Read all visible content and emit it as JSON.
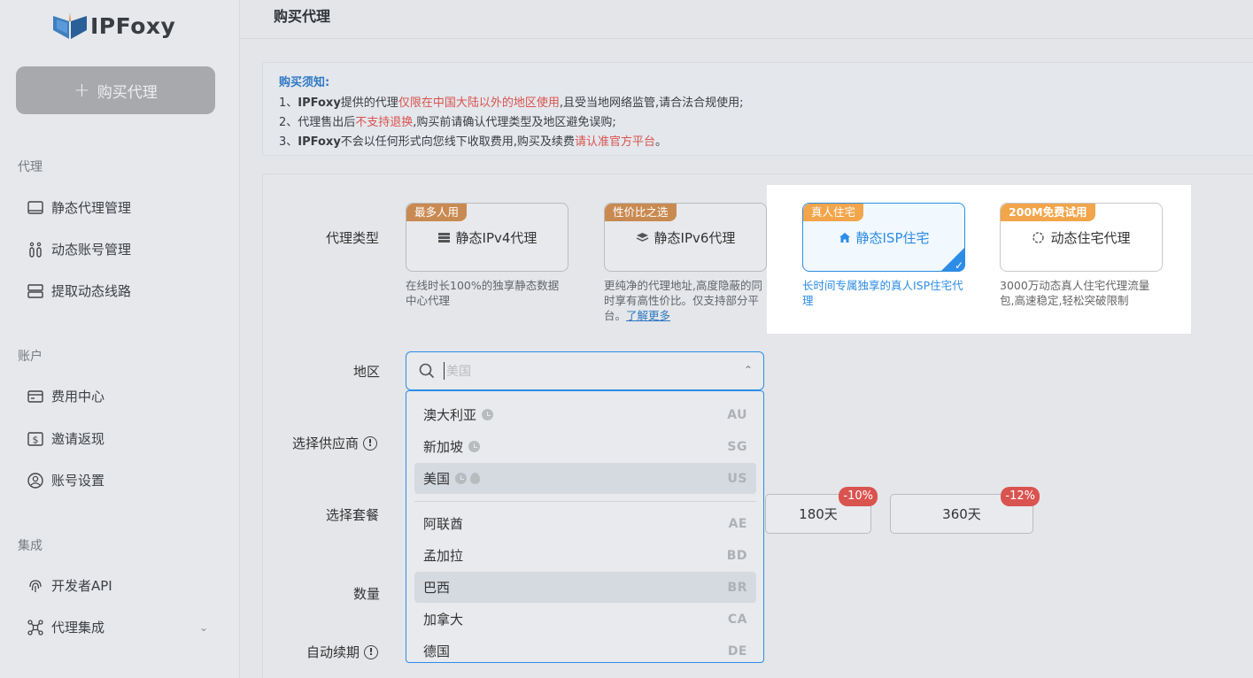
{
  "app": {
    "logo_text": "IPFoxy"
  },
  "sidebar": {
    "buy_button": "购买代理",
    "sections": {
      "proxy": "代理",
      "account": "账户",
      "integration": "集成"
    },
    "items": {
      "static_proxy": "静态代理管理",
      "dynamic_account": "动态账号管理",
      "extract_dynamic": "提取动态线路",
      "billing": "费用中心",
      "invite": "邀请返现",
      "account_settings": "账号设置",
      "developer_api": "开发者API",
      "proxy_integration": "代理集成"
    }
  },
  "page": {
    "title": "购买代理",
    "notice": {
      "title": "购买须知:",
      "line1_a": "1、",
      "line1_b": "IPFoxy",
      "line1_c": "提供的代理",
      "line1_red": "仅限在中国大陆以外的地区使用",
      "line1_d": ",且受当地网络监管,请合法合规使用;",
      "line2_a": "2、代理售出后",
      "line2_red": "不支持退换",
      "line2_b": ",购买前请确认代理类型及地区避免误购;",
      "line3_a": "3、",
      "line3_b": "IPFoxy",
      "line3_c": "不会以任何形式向您线下收取费用,购买及续费",
      "line3_red": "请认准官方平台",
      "line3_d": "。"
    },
    "labels": {
      "proxy_type": "代理类型",
      "region": "地区",
      "supplier": "选择供应商",
      "package": "选择套餐",
      "quantity": "数量",
      "auto_renew": "自动续期"
    },
    "proxy_cards": [
      {
        "tag": "最多人用",
        "title": "静态IPv4代理",
        "desc": "在线时长100%的独享静态数据中心代理"
      },
      {
        "tag": "性价比之选",
        "title": "静态IPv6代理",
        "desc": "更纯净的代理地址,高度隐蔽的同时享有高性价比。仅支持部分平台。",
        "link": "了解更多"
      },
      {
        "tag": "真人住宅",
        "title": "静态ISP住宅",
        "desc": "长时间专属独享的真人ISP住宅代理"
      },
      {
        "tag": "200M免费试用",
        "title": "动态住宅代理",
        "desc": "3000万动态真人住宅代理流量包,高速稳定,轻松突破限制"
      }
    ],
    "region_search": {
      "placeholder": "美国"
    },
    "regions": [
      {
        "name": "澳大利亚",
        "code": "AU"
      },
      {
        "name": "新加坡",
        "code": "SG"
      },
      {
        "name": "美国",
        "code": "US"
      },
      {
        "name": "阿联酋",
        "code": "AE"
      },
      {
        "name": "孟加拉",
        "code": "BD"
      },
      {
        "name": "巴西",
        "code": "BR"
      },
      {
        "name": "加拿大",
        "code": "CA"
      },
      {
        "name": "德国",
        "code": "DE"
      }
    ],
    "packages": [
      {
        "label": "180天",
        "discount": "-10%"
      },
      {
        "label": "360天",
        "discount": "-12%"
      }
    ]
  }
}
